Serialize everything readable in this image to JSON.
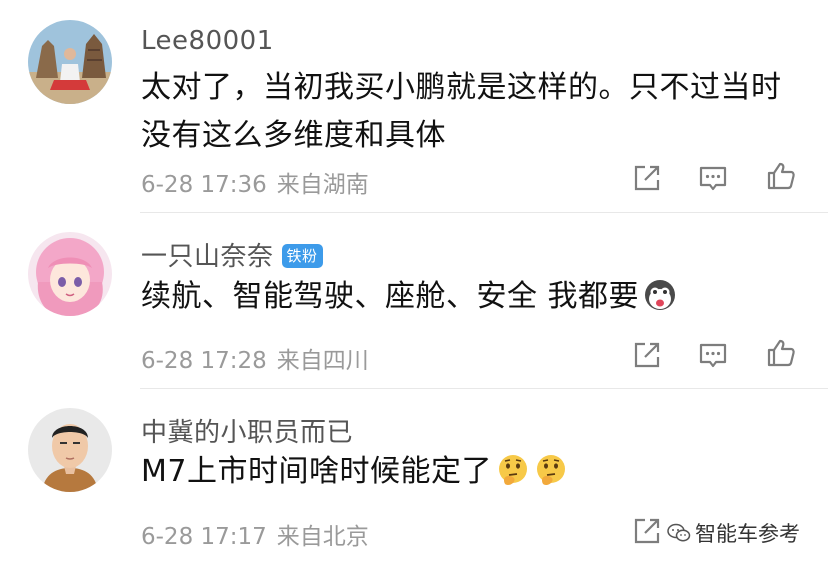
{
  "comments": [
    {
      "username": "Lee80001",
      "badge": null,
      "text": "太对了，当初我买小鹏就是这样的。只不过当时没有这么多维度和具体",
      "time": "6-28 17:36",
      "location": "来自湖南",
      "avatar": "temple-photo-avatar"
    },
    {
      "username": "一只山奈奈",
      "badge": "铁粉",
      "text": "续航、智能驾驶、座舱、安全  我都要",
      "emojis": [
        "excited-face-emoji"
      ],
      "time": "6-28 17:28",
      "location": "来自四川",
      "avatar": "anime-girl-avatar"
    },
    {
      "username": "中冀的小职员而已",
      "badge": null,
      "text": "M7上市时间啥时候能定了",
      "emojis": [
        "thinking-face-emoji",
        "thinking-face-emoji"
      ],
      "time": "6-28 17:17",
      "location": "来自北京",
      "avatar": "man-photo-avatar"
    }
  ],
  "actions": [
    "share-icon",
    "comment-icon",
    "like-icon"
  ],
  "watermark": "智能车参考",
  "colors": {
    "username": "#555555",
    "text": "#111111",
    "meta": "#9a9a9a",
    "badge": "#3d9bea",
    "divider": "#e8e8e8"
  }
}
